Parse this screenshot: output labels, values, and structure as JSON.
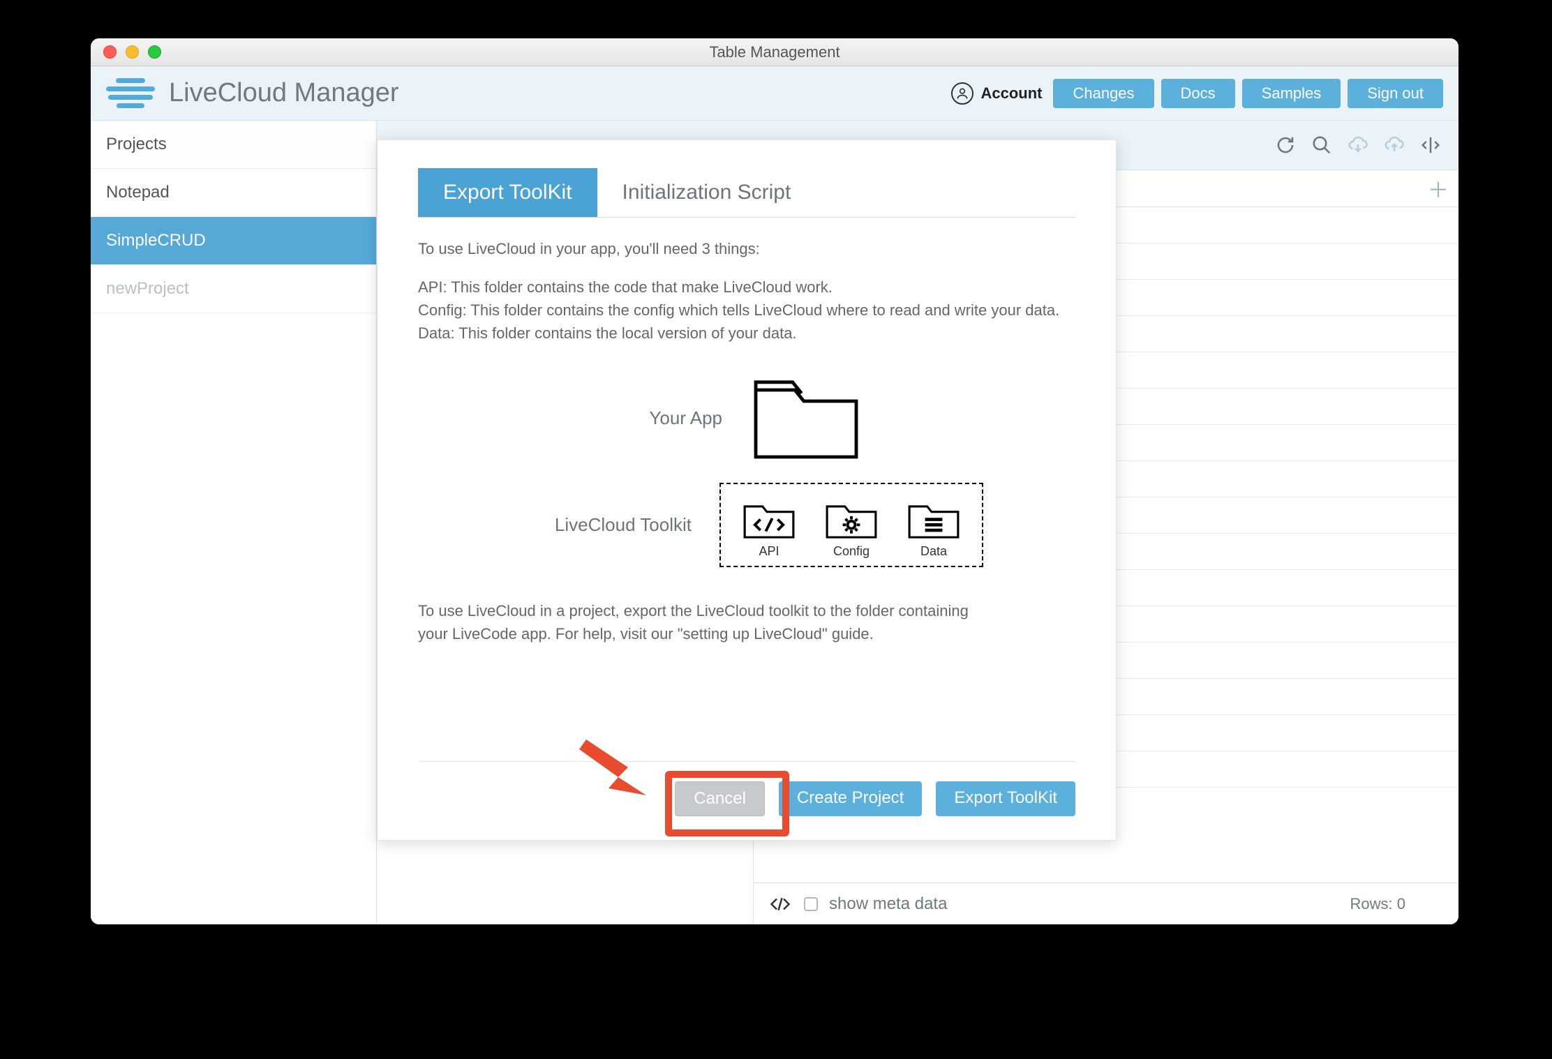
{
  "window": {
    "title": "Table Management"
  },
  "header": {
    "app_name": "LiveCloud Manager",
    "account_label": "Account",
    "buttons": {
      "changes": "Changes",
      "docs": "Docs",
      "samples": "Samples",
      "signout": "Sign out"
    }
  },
  "sidebar": {
    "header": "Projects",
    "items": [
      {
        "label": "Notepad",
        "active": false
      },
      {
        "label": "SimpleCRUD",
        "active": true
      },
      {
        "label": "newProject",
        "active": false,
        "muted": true
      }
    ]
  },
  "status": {
    "meta_label": "show meta data",
    "rows_label": "Rows: 0"
  },
  "modal": {
    "tabs": {
      "export": "Export ToolKit",
      "init": "Initialization Script"
    },
    "intro": "To use LiveCloud in your app, you'll need 3 things:",
    "line_api": "API: This folder contains the code that make LiveCloud work.",
    "line_cfg": "Config: This folder contains the config which tells LiveCloud where to read and write your data.",
    "line_data": "Data: This folder contains the local version of your data.",
    "your_app": "Your App",
    "toolkit": "LiveCloud Toolkit",
    "tk_api": "API",
    "tk_cfg": "Config",
    "tk_data": "Data",
    "outro": "To use LiveCloud in a project, export the LiveCloud toolkit to the folder containing your LiveCode app. For help, visit our \"setting up LiveCloud\" guide.",
    "btn_cancel": "Cancel",
    "btn_create": "Create Project",
    "btn_export": "Export ToolKit"
  }
}
